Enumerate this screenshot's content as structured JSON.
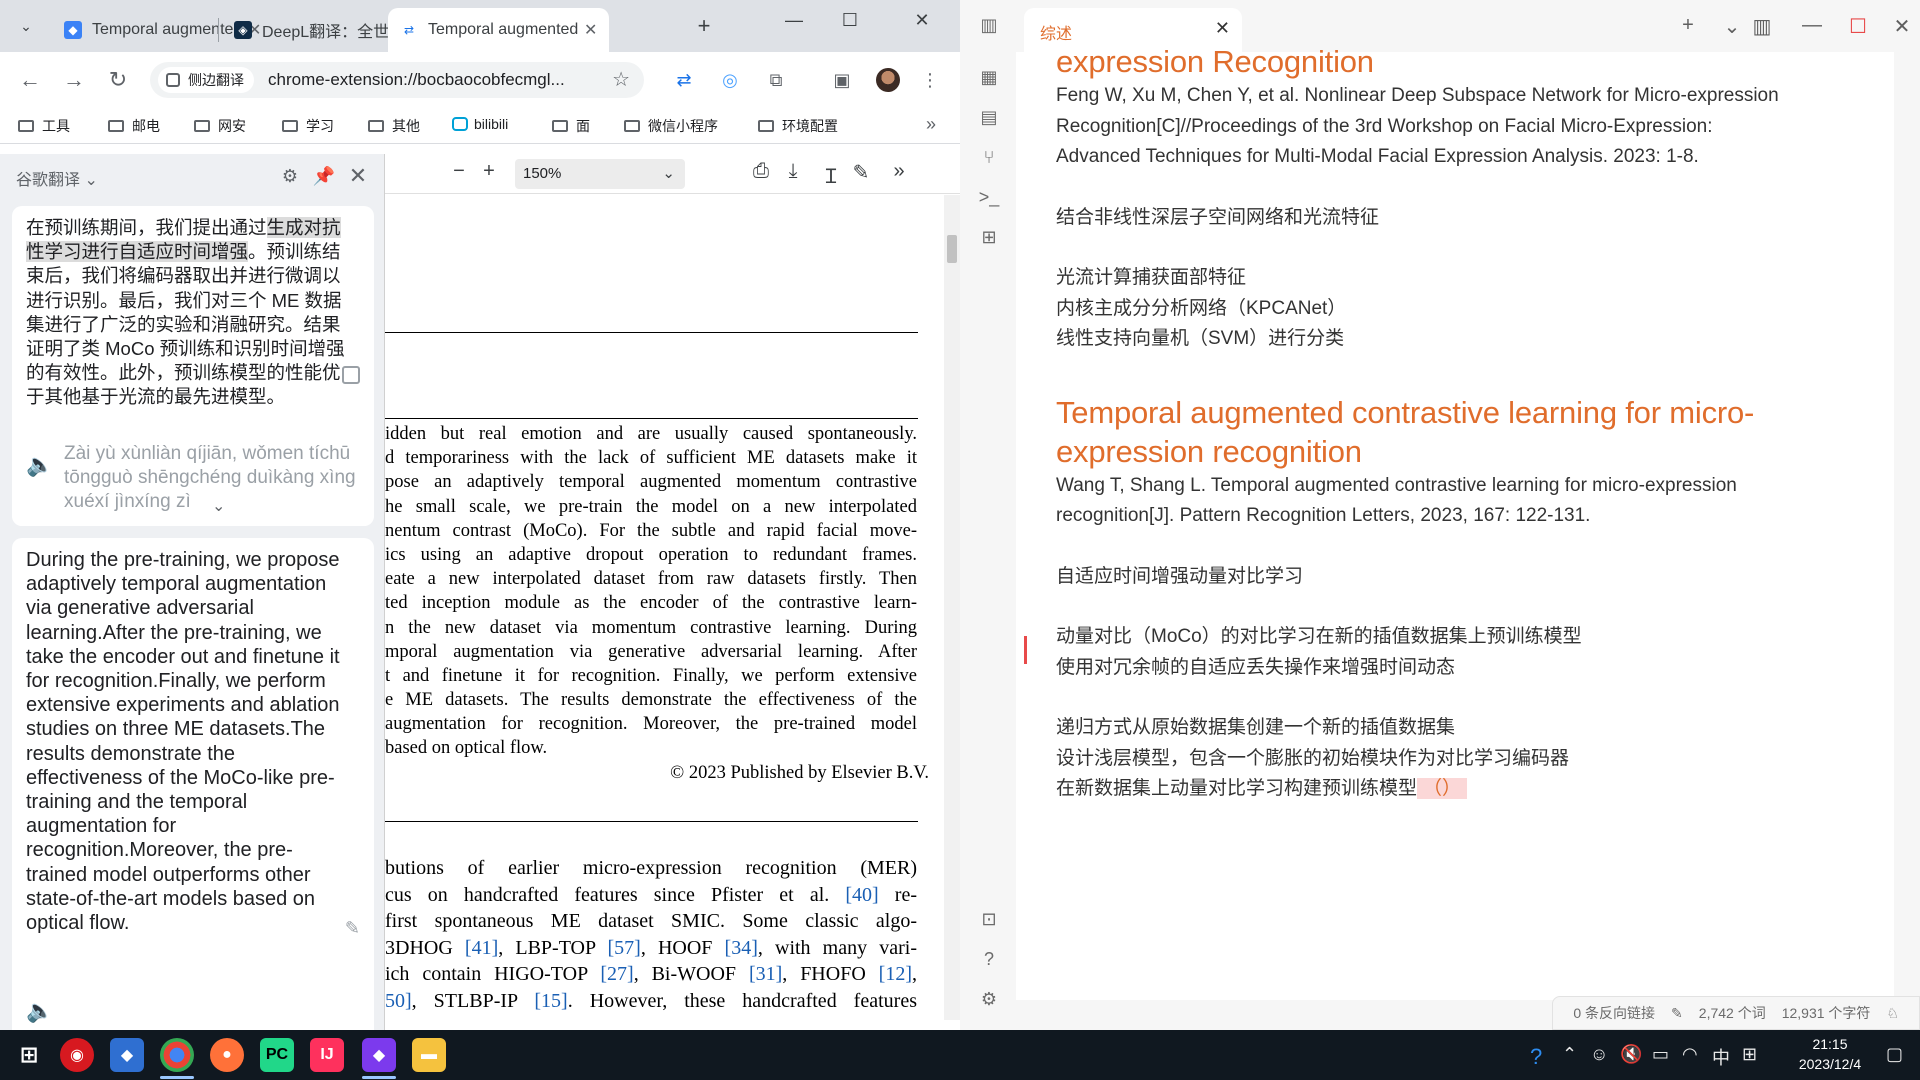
{
  "chrome": {
    "tabs": [
      {
        "title": "Temporal augmented contrastive",
        "active": false
      },
      {
        "title": "DeepL翻译：全世界最准确的翻译",
        "active": false
      },
      {
        "title": "Temporal augmented contrastive",
        "active": true
      }
    ],
    "site_chip": "侧边翻译",
    "url": "chrome-extension://bocbaocobfecmgl...",
    "bookmarks": [
      "工具",
      "邮电",
      "网安",
      "学习",
      "其他",
      "bilibili",
      "面",
      "微信小程序",
      "环境配置"
    ],
    "bookmarks_more": "»"
  },
  "translate_panel": {
    "title": "谷歌翻译",
    "source_pre": "在预训练期间，我们提出通过",
    "source_highlight": "生成对抗性学习进行自适应时间增强",
    "source_post": "。预训练结束后，我们将编码器取出并进行微调以进行识别。最后，我们对三个 ME 数据集进行了广泛的实验和消融研究。结果证明了类 MoCo 预训练和识别时间增强的有效性。此外，预训练模型的性能优于其他基于光流的最先进模型。",
    "pinyin": "Zài yù xùnliàn qíjiān, wǒmen tíchū tōngguò shēngchéng duìkàng xìng xuéxí jìnxíng zì",
    "target": "During the pre-training, we propose adaptively temporal augmentation via generative adversarial learning.After the pre-training, we take the encoder out and finetune it for recognition.Finally, we perform extensive experiments and ablation studies on three ME datasets.The results demonstrate the effectiveness of the MoCo-like pre-training and the temporal augmentation for recognition.Moreover, the pre-trained model outperforms other state-of-the-art models based on optical flow."
  },
  "pdf": {
    "zoom": "150%",
    "abstract_lines": [
      "idden but real emotion and are usually caused spontaneously.",
      "d temporariness with the lack of sufficient ME datasets make it",
      "pose an adaptively temporal augmented momentum contrastive",
      "he small scale, we pre-train the model on a new interpolated",
      "nentum contrast (MoCo). For the subtle and rapid facial move-",
      "ics using an adaptive dropout operation to redundant frames.",
      "eate a new interpolated dataset from raw datasets firstly. Then",
      "ted inception module as the encoder of the contrastive learn-",
      "n the new dataset via momentum contrastive learning. During",
      "mporal augmentation via generative adversarial learning. After",
      "t and finetune it for recognition. Finally, we perform extensive",
      "e ME datasets. The results demonstrate the effectiveness of the",
      "augmentation for recognition. Moreover, the pre-trained model",
      " based on optical flow."
    ],
    "copyright": "© 2023 Published by Elsevier B.V.",
    "body_lines": [
      {
        "pre": "butions of earlier micro-expression recognition (MER)",
        "refs": []
      },
      {
        "pre": "cus on handcrafted features since Pfister et al. ",
        "ref": "[40]",
        "post": " re-"
      },
      {
        "pre": " first spontaneous ME dataset SMIC. Some classic algo-"
      },
      {
        "pre": " 3DHOG ",
        "ref": "[41]",
        "post": ", LBP-TOP ",
        "ref2": "[57]",
        "post2": ", HOOF ",
        "ref3": "[34]",
        "post3": ", with many vari-"
      },
      {
        "pre": "ich contain HIGO-TOP ",
        "ref": "[27]",
        "post": ", Bi-WOOF ",
        "ref2": "[31]",
        "post2": ", FHOFO ",
        "ref3": "[12]",
        "post3": ","
      },
      {
        "pre": "",
        "ref": "50]",
        "post": ", STLBP-IP ",
        "ref2": "[15]",
        "post2": ". However, these handcrafted features"
      }
    ]
  },
  "obsidian": {
    "tab_title": "综述",
    "content": {
      "heading_top": "expression Recognition",
      "citation1": [
        "Feng W, Xu M, Chen Y, et al. Nonlinear Deep Subspace Network for Micro-expression",
        "Recognition[C]//Proceedings of the 3rd Workshop on Facial Micro-Expression:",
        "Advanced Techniques for Multi-Modal Facial Expression Analysis. 2023: 1-8."
      ],
      "summary1": "结合非线性深层子空间网络和光流特征",
      "points1": [
        "光流计算捕获面部特征",
        "内核主成分分析网络（KPCANet）",
        "线性支持向量机（SVM）进行分类"
      ],
      "heading2_line1": "Temporal augmented contrastive learning for micro-",
      "heading2_line2": "expression recognition",
      "citation2": [
        "Wang T, Shang L. Temporal augmented contrastive learning for micro-expression",
        "recognition[J]. Pattern Recognition Letters, 2023, 167: 122-131."
      ],
      "summary2": "自适应时间增强动量对比学习",
      "points2": [
        "动量对比（MoCo）的对比学习在新的插值数据集上预训练模型",
        "使用对冗余帧的自适应丢失操作来增强时间动态"
      ],
      "points3": [
        "递归方式从原始数据集创建一个新的插值数据集",
        "设计浅层模型，包含一个膨胀的初始模块作为对比学习编码器"
      ],
      "last_line": "在新数据集上动量对比学习构建预训练模型",
      "last_paren": "（）"
    },
    "status": {
      "backlinks": "0 条反向链接",
      "words": "2,742 个词",
      "chars": "12,931 个字符"
    }
  },
  "taskbar": {
    "ime": "中",
    "time": "21:15",
    "date": "2023/12/4"
  }
}
